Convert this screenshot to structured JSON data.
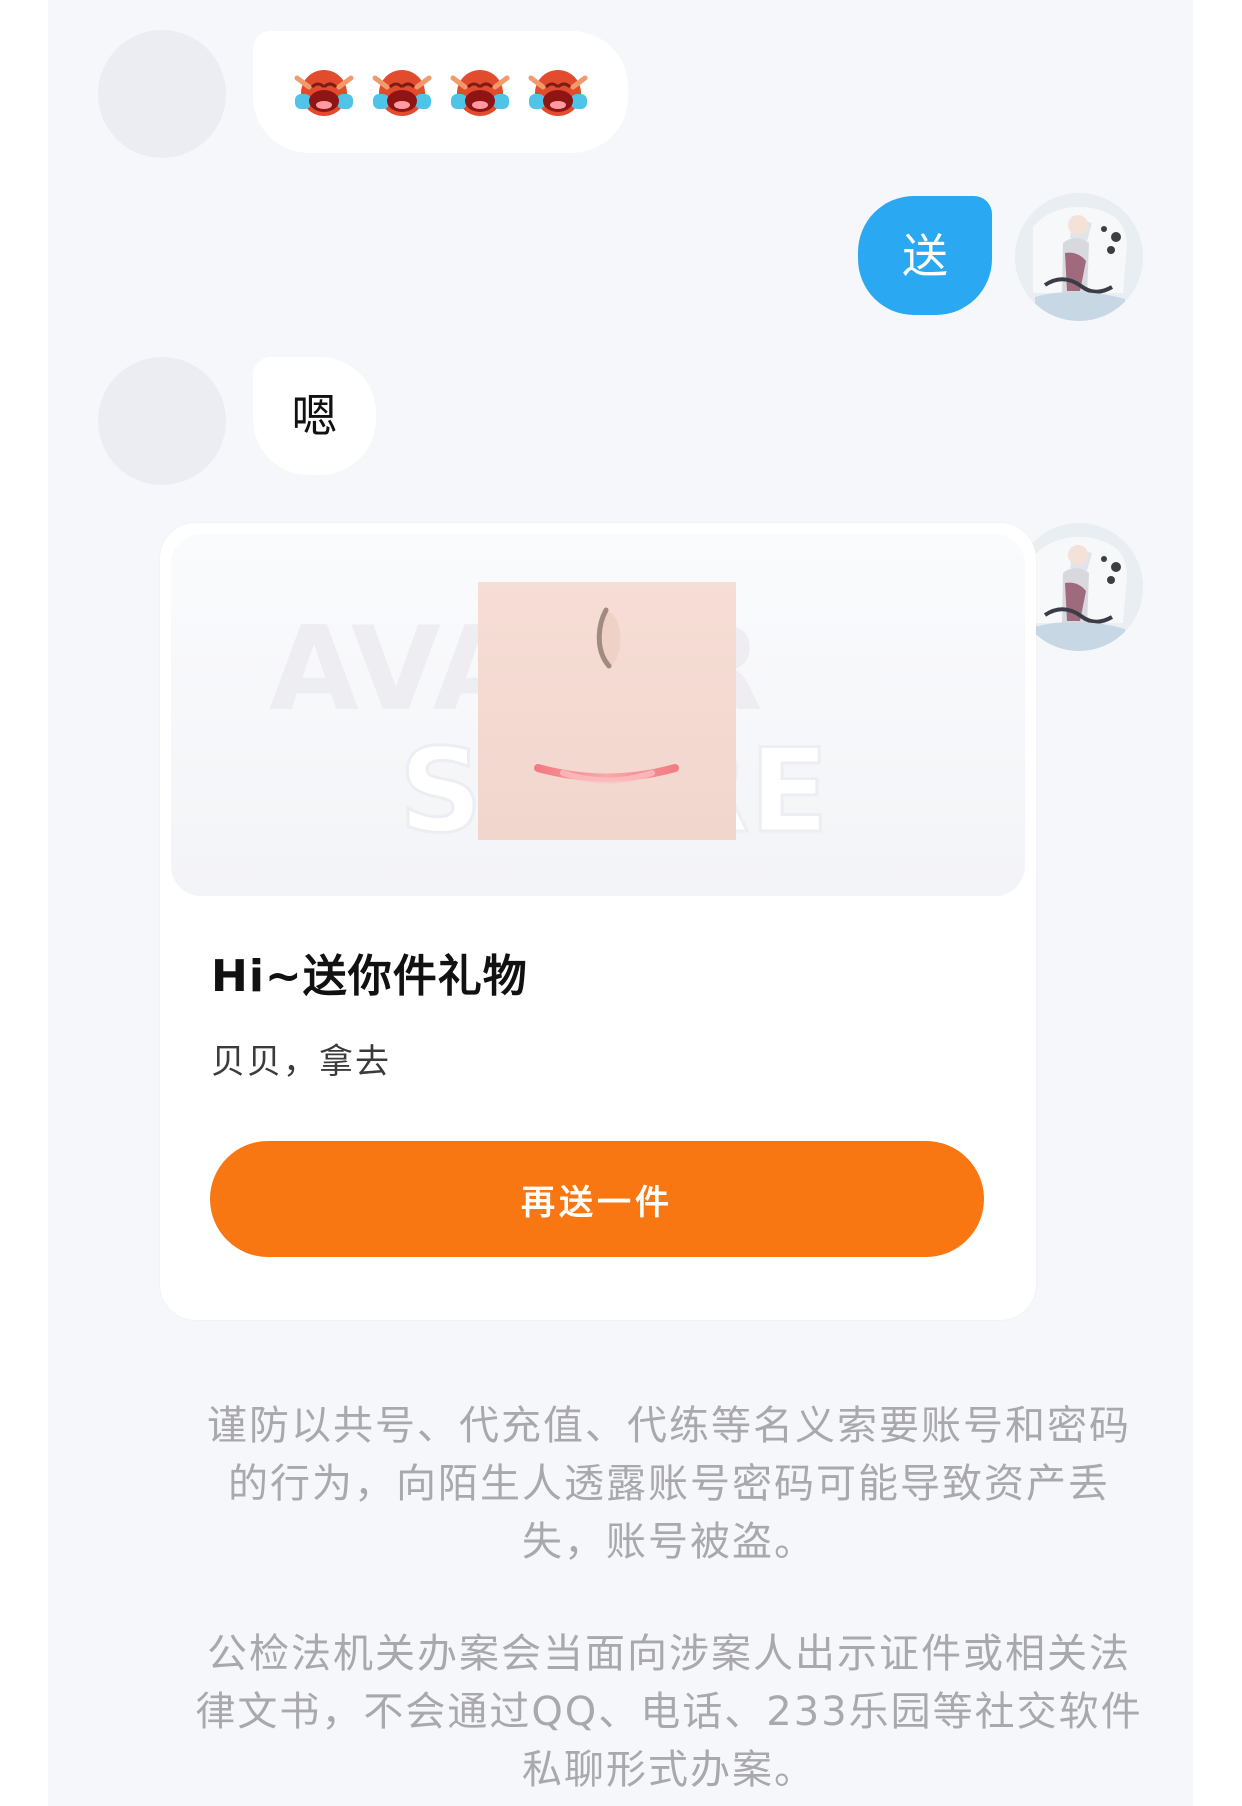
{
  "messages": {
    "crying_bubble": {
      "count": 4,
      "icon": "crying-emoji-icon"
    },
    "send_bubble_text": "送",
    "reply_bubble_text": "嗯"
  },
  "gift_card": {
    "title": "Hi~送你件礼物",
    "subtitle": "贝贝，拿去",
    "button_label": "再送一件",
    "watermark_line_1": "AVATAR",
    "watermark_line_2": "STORE"
  },
  "notices": {
    "security_notice": "谨防以共号、代充值、代练等名义索要账号和密码的行为，向陌生人透露账号密码可能导致资产丢失，账号被盗。",
    "police_notice": "公检法机关办案会当面向涉案人出示证件或相关法律文书，不会通过QQ、电话、233乐园等社交软件私聊形式办案。"
  },
  "colors": {
    "chat_background": "#f6f7fb",
    "sent_bubble": "#2aa8f2",
    "button_orange": "#f87712",
    "notice_text": "#a9a9ad"
  }
}
